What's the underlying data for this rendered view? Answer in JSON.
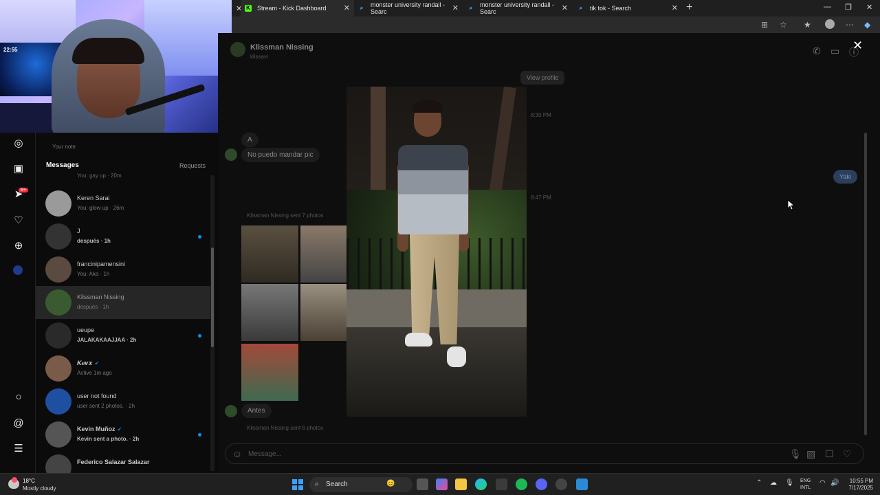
{
  "browser": {
    "tabs": [
      {
        "title": "Stream - Kick Dashboard",
        "icon": "kick-icon"
      },
      {
        "title": "monster university randall - Searc",
        "icon": "search-icon"
      },
      {
        "title": "monster university randall - Searc",
        "icon": "search-icon"
      },
      {
        "title": "tik tok - Search",
        "icon": "search-icon"
      }
    ]
  },
  "webcam": {
    "clock": "22:55"
  },
  "sidebar": {
    "note": "Your note",
    "messages_heading": "Messages",
    "requests_label": "Requests",
    "top_partial": "You: gay up · 20m",
    "conversations": [
      {
        "name": "Keren Sarai",
        "preview": "You: glow up · 26m",
        "unread": false
      },
      {
        "name": "J",
        "preview": "después · 1h",
        "unread": true
      },
      {
        "name": "francinipamensini",
        "preview": "You: Aka · 1h",
        "unread": false
      },
      {
        "name": "Klissman Nissing",
        "preview": "después · 1h",
        "unread": false
      },
      {
        "name": "ueupe",
        "preview": "JALAKAKAAJJAA · 2h",
        "unread": true
      },
      {
        "name": "𝑲𝒆𝒗𝒙",
        "preview": "Active 1m ago",
        "unread": false
      },
      {
        "name": "user not found",
        "preview": "user sent 2 photos. · 2h",
        "unread": false
      },
      {
        "name": "Kevin Muñoz",
        "preview": "Kevin sent a photo. · 2h",
        "unread": true
      },
      {
        "name": "Federico Salazar Salazar",
        "preview": "",
        "unread": false
      }
    ],
    "badge": "9+"
  },
  "chat": {
    "name": "Klissman Nissing",
    "username": "klissavi",
    "view_profile": "View profile",
    "time1": "8:30 PM",
    "msg_a": "A",
    "msg_nopuedo": "No puedo mandar pic",
    "msg_me": "Yaki",
    "time2": "8:47 PM",
    "sent_photos_1": "Klissman Nissing sent 7 photos",
    "msg_antes": "Antes",
    "sent_photos_2": "Klissman Nissing sent 6 photos",
    "composer_placeholder": "Message..."
  },
  "taskbar": {
    "temp": "18°C",
    "weather": "Mostly cloudy",
    "search": "Search",
    "lang_1": "ENG",
    "lang_2": "INTL",
    "time": "10:55 PM",
    "date": "7/17/2025"
  }
}
